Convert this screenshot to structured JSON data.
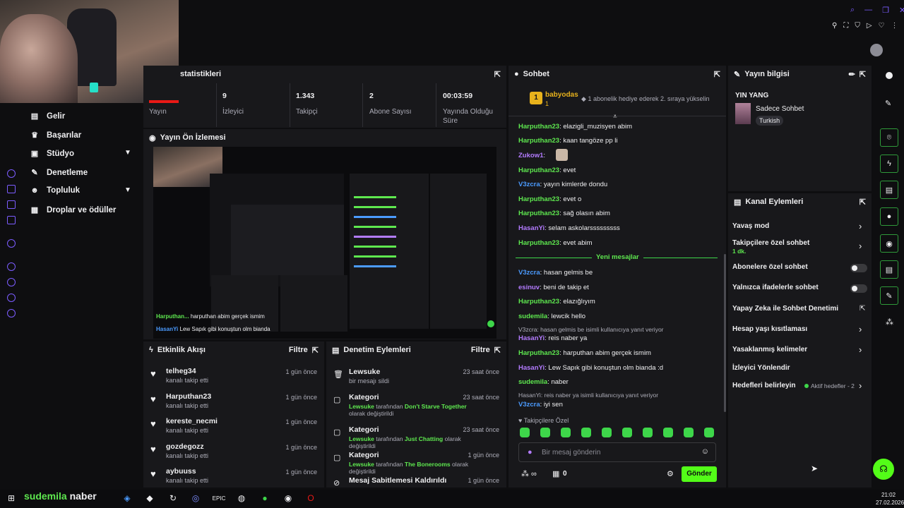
{
  "left_nav": {
    "items": [
      {
        "label": "Gelir",
        "icon": "money-icon"
      },
      {
        "label": "Başarılar",
        "icon": "trophy-icon"
      },
      {
        "label": "Stüdyo",
        "icon": "studio-icon"
      },
      {
        "label": "Denetleme",
        "icon": "wrench-icon"
      },
      {
        "label": "Topluluk",
        "icon": "people-icon"
      },
      {
        "label": "Droplar ve ödüller",
        "icon": "gift-icon"
      }
    ]
  },
  "stats": {
    "title": "statistikleri",
    "items": [
      {
        "value": "",
        "label": "Yayın"
      },
      {
        "value": "9",
        "label": "İzleyici"
      },
      {
        "value": "1.343",
        "label": "Takipçi"
      },
      {
        "value": "2",
        "label": "Abone Sayısı"
      },
      {
        "value": "00:03:59",
        "label": "Yayında Olduğu Süre"
      }
    ]
  },
  "preview": {
    "title": "Yayın Ön İzlemesi",
    "overlay_user": "Harputhan...",
    "overlay_msg": "harputhan abim gerçek ismim",
    "overlay_user2": "HasanYi",
    "overlay_msg2": "Lew Sapık gibi konuştun olm bianda"
  },
  "activity": {
    "title": "Etkinlik Akışı",
    "filter": "Filtre",
    "items": [
      {
        "name": "telheg34",
        "sub": "kanalı takip etti",
        "time": "1 gün önce"
      },
      {
        "name": "Harputhan23",
        "sub": "kanalı takip etti",
        "time": "1 gün önce"
      },
      {
        "name": "kereste_necmi",
        "sub": "kanalı takip etti",
        "time": "1 gün önce"
      },
      {
        "name": "gozdegozz",
        "sub": "kanalı takip etti",
        "time": "1 gün önce"
      },
      {
        "name": "aybuuss",
        "sub": "kanalı takip etti",
        "time": "1 gün önce"
      }
    ]
  },
  "moderation": {
    "title": "Denetim Eylemleri",
    "filter": "Filtre",
    "items": [
      {
        "name": "Lewsuke",
        "sub": "bir mesajı sildi",
        "time": "23 saat önce"
      },
      {
        "name": "Kategori",
        "user": "Lewsuke",
        "mid": " tarafından ",
        "game": "Don't Starve Together",
        "end": " olarak değiştirildi",
        "time": "23 saat önce"
      },
      {
        "name": "Kategori",
        "user": "Lewsuke",
        "mid": " tarafından ",
        "game": "Just Chatting",
        "end": " olarak değiştirildi",
        "time": "23 saat önce"
      },
      {
        "name": "Kategori",
        "user": "Lewsuke",
        "mid": " tarafından ",
        "game": "The Bonerooms",
        "end": " olarak değiştirildi",
        "time": "1 gün önce"
      },
      {
        "name": "Mesaj Sabitlemesi Kaldırıldı",
        "time": "1 gün önce"
      }
    ]
  },
  "chat": {
    "title": "Sohbet",
    "pinned_user": "babyodas",
    "pinned_count": "1",
    "pinned_text": "1 abonelik hediye ederek 2. sıraya yükselin",
    "new_messages": "Yeni mesajlar",
    "messages": [
      {
        "user": "Harputhan23",
        "color": "g",
        "text": ": elazigli_muzisyen abim"
      },
      {
        "user": "Harputhan23",
        "color": "g",
        "text": ": kaan tangöze pp li"
      },
      {
        "user": "Zukow1",
        "color": "p",
        "text": ": "
      },
      {
        "user": "Harputhan23",
        "color": "g",
        "text": ": evet"
      },
      {
        "user": "V3zcra",
        "color": "b",
        "text": ": yayın kimlerde dondu"
      },
      {
        "user": "Harputhan23",
        "color": "g",
        "text": ": evet o"
      },
      {
        "user": "Harputhan23",
        "color": "g",
        "text": ": sağ olasın abim"
      },
      {
        "user": "HasanYi",
        "color": "p",
        "text": ": selam askolarsssssssss"
      },
      {
        "user": "Harputhan23",
        "color": "g",
        "text": ": evet abim"
      }
    ],
    "messages2": [
      {
        "user": "V3zcra",
        "color": "b",
        "text": ": hasan gelmis be"
      },
      {
        "user": "esinuv",
        "color": "p",
        "text": ": beni de takip et"
      },
      {
        "user": "Harputhan23",
        "color": "g",
        "text": ": elazığlıyım"
      },
      {
        "user": "sudemila",
        "color": "g",
        "text": ": lewcik hello"
      },
      {
        "reply": "V3zcra: hasan gelmis be isimli kullanıcıya yanıt veriyor"
      },
      {
        "user": "HasanYi",
        "color": "p",
        "text": ": reis naber ya"
      },
      {
        "user": "Harputhan23",
        "color": "g",
        "text": ": harputhan abim gerçek ismim"
      },
      {
        "user": "HasanYi",
        "color": "p",
        "text": ": Lew Sapık gibi konuştun olm bianda :d"
      },
      {
        "user": "sudemila",
        "color": "g",
        "text": ": naber"
      },
      {
        "reply": "HasanYi: reis naber ya isimli kullanıcıya yanıt veriyor"
      },
      {
        "user": "V3zcra",
        "color": "b",
        "text": ": iyi sen"
      }
    ],
    "followers_only": "Takipçilere Özel",
    "input_placeholder": "Bir mesaj gönderin",
    "points": "0",
    "send": "Gönder"
  },
  "stream_info": {
    "title": "Yayın bilgisi",
    "stream_title": "YIN YANG",
    "category": "Sadece Sohbet",
    "tag": "Turkish"
  },
  "channel_actions": {
    "title": "Kanal Eylemleri",
    "items": [
      {
        "label": "Yavaş mod",
        "type": "chev"
      },
      {
        "label": "Takipçilere özel sohbet",
        "sub": "1 dk.",
        "type": "chev"
      },
      {
        "label": "Abonelere özel sohbet",
        "type": "toggle"
      },
      {
        "label": "Yalnızca ifadelerle sohbet",
        "type": "toggle"
      },
      {
        "label": "Yapay Zeka ile Sohbet Denetimi",
        "type": "ext"
      },
      {
        "label": "Hesap yaşı kısıtlaması",
        "type": "chev"
      },
      {
        "label": "Yasaklanmış kelimeler",
        "type": "chev"
      },
      {
        "label": "İzleyici Yönlendir",
        "type": "none"
      },
      {
        "label": "Hedefleri belirleyin",
        "goal": "Aktif hedefler - 2",
        "type": "chev"
      }
    ]
  },
  "taskbar": {
    "overlay_user": "sudemila",
    "overlay_msg": "naber",
    "time": "21:02",
    "date": "27.02.2026"
  },
  "colors": {
    "accent": "#53fc18",
    "bg": "#0e0e10",
    "panel": "#18181b"
  }
}
